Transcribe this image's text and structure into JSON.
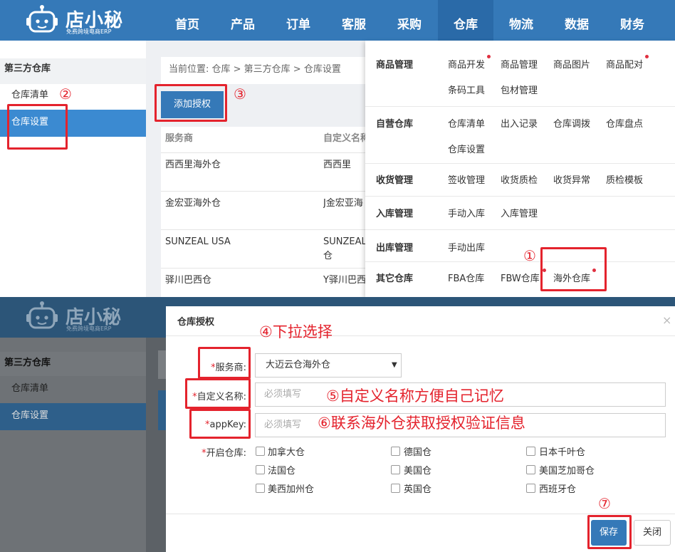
{
  "brand": {
    "name": "店小秘",
    "tagline": "免费跨境电商ERP"
  },
  "nav": [
    "首页",
    "产品",
    "订单",
    "客服",
    "采购",
    "仓库",
    "物流",
    "数据",
    "财务"
  ],
  "nav_active": "仓库",
  "sidebar": {
    "section": "第三方仓库",
    "items": [
      "仓库清单",
      "仓库设置"
    ],
    "selected": "仓库设置"
  },
  "breadcrumb": "当前位置:  仓库 > 第三方仓库 > 仓库设置",
  "add_button": "添加授权",
  "table": {
    "headers": [
      "服务商",
      "自定义名称"
    ],
    "rows": [
      [
        "西西里海外仓",
        "西西里"
      ],
      [
        "金宏亚海外仓",
        "J金宏亚海"
      ],
      [
        "SUNZEAL USA",
        "SUNZEAL",
        "仓"
      ],
      [
        "驿川巴西仓",
        "Y驿川巴西"
      ]
    ]
  },
  "menu": {
    "groups": [
      {
        "title": "商品管理",
        "items": [
          "商品开发",
          "商品管理",
          "商品图片",
          "商品配对",
          "条码工具",
          "包材管理"
        ]
      },
      {
        "title": "自营仓库",
        "items": [
          "仓库清单",
          "出入记录",
          "仓库调拨",
          "仓库盘点",
          "仓库设置"
        ]
      },
      {
        "title": "收货管理",
        "items": [
          "签收管理",
          "收货质检",
          "收货异常",
          "质检模板"
        ]
      },
      {
        "title": "入库管理",
        "items": [
          "手动入库",
          "入库管理"
        ]
      },
      {
        "title": "出库管理",
        "items": [
          "手动出库"
        ]
      },
      {
        "title": "其它仓库",
        "items": [
          "FBA仓库",
          "FBW仓库",
          "海外仓库"
        ]
      }
    ]
  },
  "annotations": {
    "a1": "①",
    "a2": "②",
    "a3": "③",
    "a4": "④下拉选择",
    "a5": "⑤自定义名称方便自己记忆",
    "a6": "⑥联系海外仓获取授权验证信息",
    "a7": "⑦"
  },
  "modal": {
    "title": "仓库授权",
    "close": "×",
    "fields": {
      "provider_label": "服务商:",
      "provider_value": "大迈云仓海外仓",
      "name_label": "自定义名称:",
      "name_placeholder": "必须填写",
      "appkey_label": "appKey:",
      "appkey_placeholder": "必须填写",
      "warehouses_label": "开启仓库:"
    },
    "warehouses": [
      "加拿大仓",
      "德国仓",
      "日本千叶仓",
      "法国仓",
      "美国仓",
      "美国芝加哥仓",
      "美西加州仓",
      "英国仓",
      "西班牙仓"
    ],
    "save": "保存",
    "cancel": "关闭"
  },
  "colors": {
    "primary": "#3579b8",
    "annotation": "#e4232d"
  }
}
